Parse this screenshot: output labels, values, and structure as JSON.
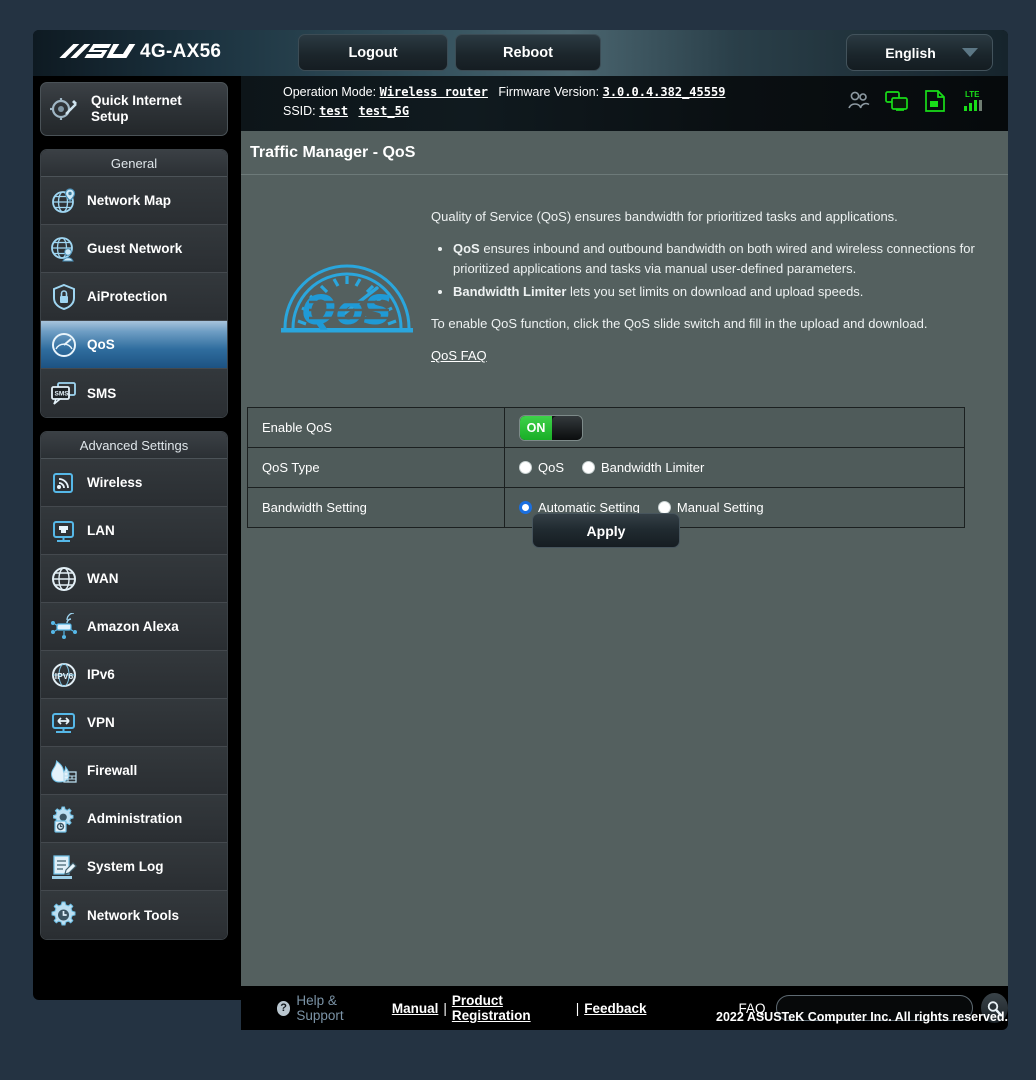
{
  "header": {
    "brand": "/ISUS",
    "model": "4G-AX56",
    "logout_label": "Logout",
    "reboot_label": "Reboot",
    "language": "English"
  },
  "info": {
    "operation_mode_label": "Operation Mode:",
    "operation_mode_value": "Wireless router",
    "firmware_label": "Firmware Version:",
    "firmware_value": "3.0.0.4.382_45559",
    "ssid_label": "SSID:",
    "ssid_1": "test",
    "ssid_2": "test_5G",
    "icons": [
      "clients-group-icon",
      "network-clients-icon",
      "system-log-icon",
      "lte-signal-icon"
    ]
  },
  "sidebar": {
    "quick_internet_setup": "Quick Internet\nSetup",
    "quick_internet_setup_line1": "Quick Internet",
    "quick_internet_setup_line2": "Setup",
    "general_header": "General",
    "general_items": [
      {
        "label": "Network Map",
        "icon": "network-map-icon",
        "active": false
      },
      {
        "label": "Guest Network",
        "icon": "guest-network-icon",
        "active": false
      },
      {
        "label": "AiProtection",
        "icon": "shield-lock-icon",
        "active": false
      },
      {
        "label": "QoS",
        "icon": "qos-gauge-icon",
        "active": true
      },
      {
        "label": "SMS",
        "icon": "sms-icon",
        "active": false
      }
    ],
    "advanced_header": "Advanced Settings",
    "advanced_items": [
      {
        "label": "Wireless",
        "icon": "wireless-icon"
      },
      {
        "label": "LAN",
        "icon": "lan-port-icon"
      },
      {
        "label": "WAN",
        "icon": "globe-icon"
      },
      {
        "label": "Amazon Alexa",
        "icon": "alexa-icon"
      },
      {
        "label": "IPv6",
        "icon": "ipv6-icon"
      },
      {
        "label": "VPN",
        "icon": "vpn-icon"
      },
      {
        "label": "Firewall",
        "icon": "firewall-flame-icon"
      },
      {
        "label": "Administration",
        "icon": "administration-gear-icon"
      },
      {
        "label": "System Log",
        "icon": "system-log-pencil-icon"
      },
      {
        "label": "Network Tools",
        "icon": "network-tools-gear-icon"
      }
    ]
  },
  "main": {
    "page_title": "Traffic Manager - QoS",
    "intro": "Quality of Service (QoS) ensures bandwidth for prioritized tasks and applications.",
    "bullets": [
      {
        "bold": "QoS",
        "text": " ensures inbound and outbound bandwidth on both wired and wireless connections for prioritized applications and tasks via manual user-defined parameters."
      },
      {
        "bold": "Bandwidth Limiter",
        "text": " lets you set limits on download and upload speeds."
      }
    ],
    "closing": "To enable QoS function, click the QoS slide switch and fill in the upload and download.",
    "faq_link": "QoS FAQ",
    "graphic_text": "QoS",
    "rows": {
      "enable_qos_label": "Enable QoS",
      "enable_qos_state": "ON",
      "qos_type_label": "QoS Type",
      "qos_type_options": [
        {
          "label": "QoS",
          "selected": false
        },
        {
          "label": "Bandwidth Limiter",
          "selected": false
        }
      ],
      "bandwidth_setting_label": "Bandwidth Setting",
      "bandwidth_setting_options": [
        {
          "label": "Automatic Setting",
          "selected": true
        },
        {
          "label": "Manual Setting",
          "selected": false
        }
      ]
    },
    "apply_label": "Apply"
  },
  "footer": {
    "help_icon_glyph": "?",
    "help_support": "Help & Support",
    "manual": "Manual",
    "separator": "|",
    "product_registration": "Product Registration",
    "feedback": "Feedback",
    "faq_label": "FAQ",
    "faq_value": "",
    "faq_placeholder": "",
    "search_icon": "search-icon",
    "copyright": "2022 ASUSTeK Computer Inc. All rights reserved."
  },
  "colors": {
    "accent_blue": "#2f6d9e",
    "toggle_green": "#19ae26",
    "icon_cyan": "#35b4e8",
    "status_green": "#19dd19",
    "page_bg": "#243342",
    "content_bg": "#54605f"
  }
}
